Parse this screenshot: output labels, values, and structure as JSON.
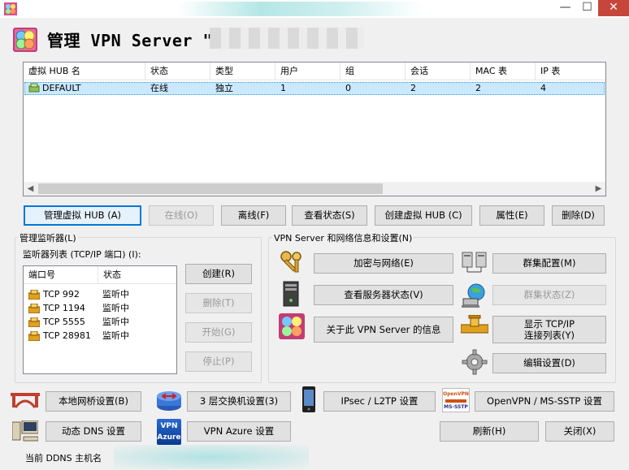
{
  "window": {
    "minimize": "—",
    "maximize": "☐",
    "close": "✕"
  },
  "header": {
    "title": "管理 VPN Server \""
  },
  "hub_table": {
    "columns": [
      "虚拟 HUB 名",
      "状态",
      "类型",
      "用户",
      "组",
      "会话",
      "MAC 表",
      "IP 表"
    ],
    "rows": [
      {
        "name": "DEFAULT",
        "status": "在线",
        "type": "独立",
        "users": "1",
        "groups": "0",
        "sessions": "2",
        "mac": "2",
        "ip": "4"
      }
    ]
  },
  "hub_buttons": {
    "manage": "管理虚拟 HUB (A)",
    "online": "在线(O)",
    "offline": "离线(F)",
    "status": "查看状态(S)",
    "create": "创建虚拟 HUB (C)",
    "properties": "属性(E)",
    "delete": "删除(D)"
  },
  "listener": {
    "group_title": "管理监听器(L)",
    "list_label": "监听器列表 (TCP/IP 端口) (I):",
    "columns": [
      "端口号",
      "状态"
    ],
    "rows": [
      {
        "port": "TCP 992",
        "state": "监听中"
      },
      {
        "port": "TCP 1194",
        "state": "监听中"
      },
      {
        "port": "TCP 5555",
        "state": "监听中"
      },
      {
        "port": "TCP 28981",
        "state": "监听中"
      }
    ],
    "buttons": {
      "create": "创建(R)",
      "delete": "删除(T)",
      "start": "开始(G)",
      "stop": "停止(P)"
    }
  },
  "vpn_info": {
    "group_title": "VPN Server 和网络信息和设置(N)",
    "encryption": "加密与网络(E)",
    "server_status": "查看服务器状态(V)",
    "about": "关于此 VPN Server 的信息",
    "cluster_config": "群集配置(M)",
    "cluster_status": "群集状态(Z)",
    "tcpip_line1": "显示 TCP/IP",
    "tcpip_line2": "连接列表(Y)",
    "edit_config": "编辑设置(D)"
  },
  "bottom": {
    "local_bridge": "本地网桥设置(B)",
    "l3_switch": "3 层交换机设置(3)",
    "ipsec": "IPsec / L2TP 设置",
    "openvpn": "OpenVPN / MS-SSTP 设置",
    "openvpn_logo_top": "OpenVPN",
    "openvpn_logo_bottom": "MS-SSTP",
    "ddns": "动态 DNS 设置",
    "vpn_azure": "VPN Azure 设置",
    "azure_logo_top": "VPN",
    "azure_logo_bottom": "Azure",
    "refresh": "刷新(H)",
    "close": "关闭(X)",
    "ddns_host_label": "当前 DDNS 主机名"
  }
}
